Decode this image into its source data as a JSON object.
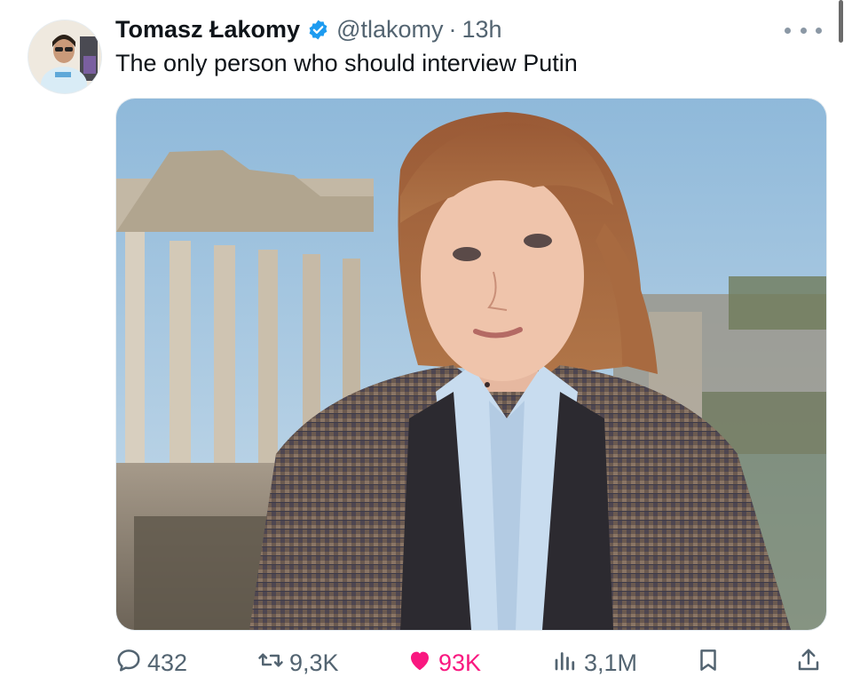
{
  "tweet": {
    "author_name": "Tomasz Łakomy",
    "handle": "@tlakomy",
    "separator": "·",
    "time": "13h",
    "text": "The only person who should interview Putin",
    "verified_color": "#1d9bf0"
  },
  "actions": {
    "reply_count": "432",
    "retweet_count": "9,3K",
    "like_count": "93K",
    "views_count": "3,1M"
  },
  "icons": {
    "avatar": "avatar",
    "verified": "verified-badge-icon",
    "more": "more-icon",
    "reply": "reply-icon",
    "retweet": "retweet-icon",
    "like": "heart-icon",
    "views": "views-icon",
    "bookmark": "bookmark-icon",
    "share": "share-icon"
  },
  "colors": {
    "like_active": "#f91880",
    "muted": "#536471",
    "text": "#0f1419"
  }
}
